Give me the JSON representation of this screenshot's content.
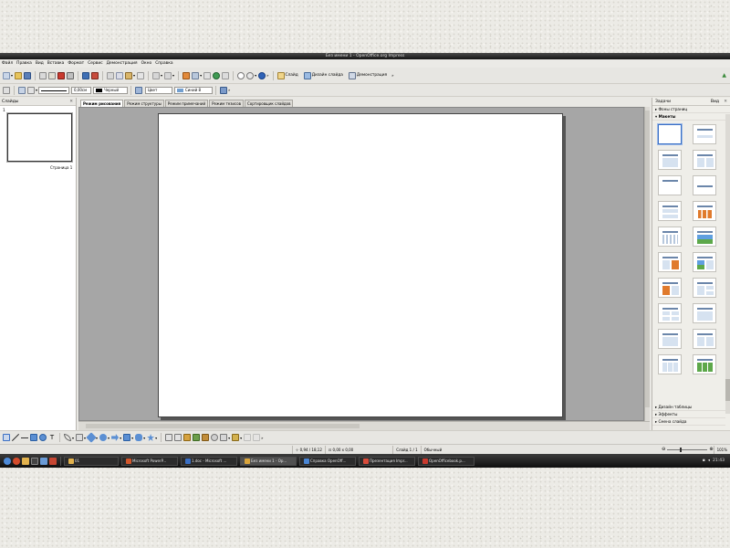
{
  "window": {
    "title": "Без имени 1 - OpenOffice.org Impress"
  },
  "menu": [
    "Файл",
    "Правка",
    "Вид",
    "Вставка",
    "Формат",
    "Сервис",
    "Демонстрация",
    "Окно",
    "Справка"
  ],
  "toolbar1": {
    "slide_label": "Слайд",
    "design_label": "Дизайн слайда",
    "show_label": "Демонстрация"
  },
  "toolbar2": {
    "line_width": "0,00см",
    "line_color": "Черный",
    "area_type": "Цвет",
    "area_color": "Синий 8"
  },
  "left_panel": {
    "title": "Слайды",
    "slide_number": "1",
    "slide_label": "Страница 1"
  },
  "tabs": [
    "Режим рисования",
    "Режим структуры",
    "Режим примечаний",
    "Режим тезисов",
    "Сортировщик слайдов"
  ],
  "right_panel": {
    "title": "Задачи",
    "view_label": "Вид",
    "sections": {
      "master_pages": "Фоны страниц",
      "layouts": "Макеты",
      "table_design": "Дизайн таблицы",
      "effects": "Эффекты",
      "transition": "Смена слайда"
    }
  },
  "status": {
    "position": "0,94 / 18,12",
    "size": "0,00 x 0,00",
    "slide": "Слайд 1 / 1",
    "master": "Обычный",
    "zoom": "101%"
  },
  "taskbar": {
    "items": [
      "01",
      "Microsoft PowerP...",
      "1.doc - Microsoft ...",
      "Без имени 1 - Op...",
      "Справка OpenOff...",
      "Презентация Impr...",
      "OpenOfficebook.p..."
    ],
    "clock": "21:43"
  },
  "colors": {
    "accent": "#3a6fc4",
    "titlebar": "#1e1e1e"
  }
}
